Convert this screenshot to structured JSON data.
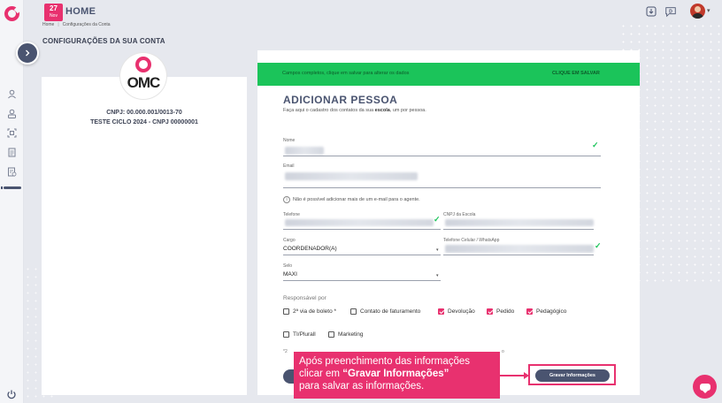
{
  "topbar": {
    "date_day": "27",
    "date_month": "Nov",
    "title": "HOME"
  },
  "breadcrumb": {
    "home": "Home",
    "current": "Configurações da Conta"
  },
  "page_heading": "CONFIGURAÇÕES DA SUA CONTA",
  "account": {
    "logo_text": "OMC",
    "cnpj": "CNPJ: 00.000.001/0013-70",
    "name": "TESTE CICLO 2024 - CNPJ 00000001"
  },
  "banner": {
    "message": "Campos completos, clique em salvar para alterar os dados",
    "action": "CLIQUE EM SALVAR",
    "color": "#1bc45a"
  },
  "form": {
    "title": "ADICIONAR PESSOA",
    "subtitle_pre": "Faça aqui o cadastro dos contatos da sua ",
    "subtitle_bold": "escola",
    "subtitle_post": ", um por pessoa.",
    "nome_label": "Nome",
    "email_label": "Email",
    "email_info": "Não é possível adicionar mais de um e-mail para o agente.",
    "telefone_label": "Telefone",
    "cnpj_escola_label": "CNPJ da Escola",
    "cargo_label": "Cargo",
    "cargo_value": "COORDENADOR(A)",
    "celular_label": "Telefone Celular / WhatsApp",
    "selo_label": "Selo",
    "selo_value": "MAXI",
    "responsavel_label": "Responsável por",
    "checkboxes": [
      {
        "label": "2ª via de boleto *",
        "checked": false
      },
      {
        "label": "Contato de faturamento",
        "checked": false
      },
      {
        "label": "Devolução",
        "checked": true
      },
      {
        "label": "Pedido",
        "checked": true
      },
      {
        "label": "Pedagógico",
        "checked": true
      },
      {
        "label": "TI/Plurall",
        "checked": false
      },
      {
        "label": "Marketing",
        "checked": false
      }
    ],
    "footnote": "*2",
    "footnote_tail": "o",
    "save_label": "Gravar Informações"
  },
  "callout": {
    "line1": "Após preenchimento das informações",
    "line2_pre": "clicar em ",
    "line2_bold": "“Gravar Informações”",
    "line3": "para salvar as informações."
  },
  "colors": {
    "brand": "#e8316f",
    "navy": "#4a5470",
    "success": "#1bc45a"
  },
  "icons": [
    "logo-icon",
    "expand-icon",
    "user-icon",
    "user-badge-icon",
    "scan-icon",
    "document-icon",
    "report-icon",
    "power-icon",
    "download-icon",
    "chat-d-icon",
    "chevron-down-icon",
    "chat-icon",
    "check-icon",
    "info-icon"
  ]
}
